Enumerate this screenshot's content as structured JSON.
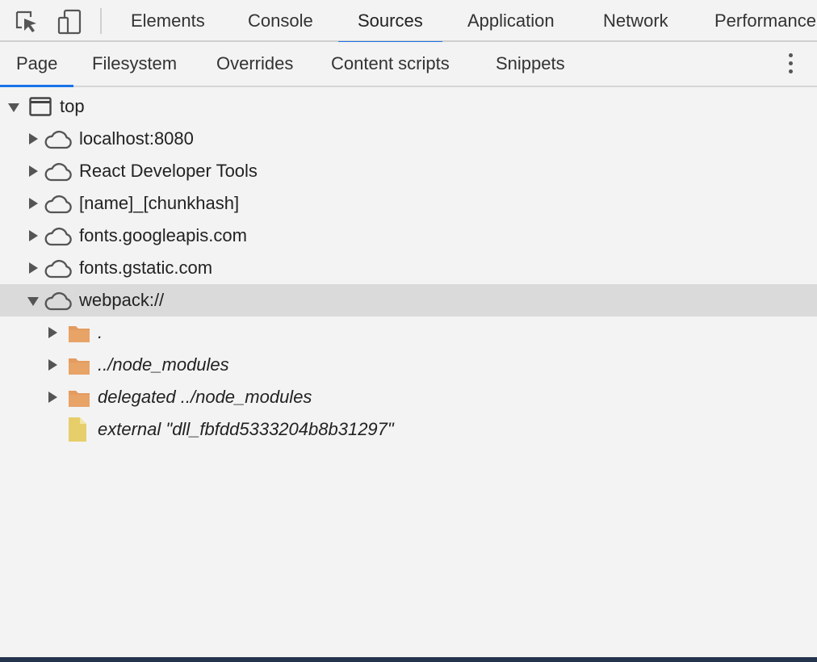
{
  "toolbar": {
    "inspect_icon": "inspect-element-icon",
    "device_icon": "device-toolbar-icon",
    "tabs": [
      {
        "label": "Elements"
      },
      {
        "label": "Console"
      },
      {
        "label": "Sources"
      },
      {
        "label": "Application"
      },
      {
        "label": "Network"
      },
      {
        "label": "Performance"
      }
    ],
    "active_tab": "Sources"
  },
  "subtabs": {
    "items": [
      {
        "label": "Page"
      },
      {
        "label": "Filesystem"
      },
      {
        "label": "Overrides"
      },
      {
        "label": "Content scripts"
      },
      {
        "label": "Snippets"
      }
    ],
    "active": "Page",
    "more_icon": "more-vertical-icon"
  },
  "tree": {
    "rows": [
      {
        "label": "top",
        "icon": "frame-icon",
        "expanded": true
      },
      {
        "label": "localhost:8080",
        "icon": "cloud-icon",
        "expanded": false
      },
      {
        "label": "React Developer Tools",
        "icon": "cloud-icon",
        "expanded": false
      },
      {
        "label": "[name]_[chunkhash]",
        "icon": "cloud-icon",
        "expanded": false
      },
      {
        "label": "fonts.googleapis.com",
        "icon": "cloud-icon",
        "expanded": false
      },
      {
        "label": "fonts.gstatic.com",
        "icon": "cloud-icon",
        "expanded": false
      },
      {
        "label": "webpack://",
        "icon": "cloud-icon",
        "expanded": true,
        "selected": true
      },
      {
        "label": ".",
        "icon": "folder-icon",
        "expanded": false
      },
      {
        "label": "../node_modules",
        "icon": "folder-icon",
        "expanded": false
      },
      {
        "label": "delegated ../node_modules",
        "icon": "folder-icon",
        "expanded": false
      },
      {
        "label": "external \"dll_fbfdd5333204b8b31297\"",
        "icon": "file-icon"
      }
    ]
  },
  "colors": {
    "accent": "#1a73e8",
    "folder": "#e49b5e",
    "file": "#e6cf6a",
    "selected_row": "#dadada",
    "background": "#f3f3f3"
  }
}
